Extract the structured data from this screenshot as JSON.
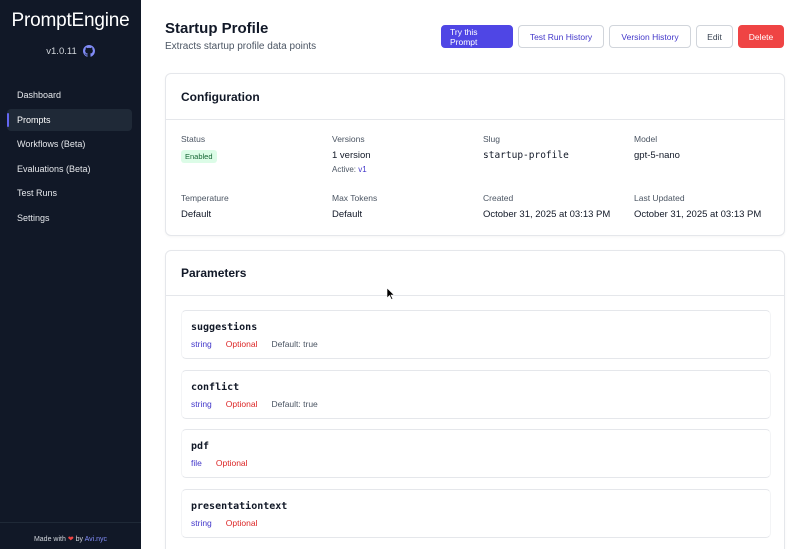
{
  "sidebar": {
    "brand": "PromptEngine",
    "version": "v1.0.11",
    "items": [
      {
        "label": "Dashboard"
      },
      {
        "label": "Prompts"
      },
      {
        "label": "Workflows (Beta)"
      },
      {
        "label": "Evaluations (Beta)"
      },
      {
        "label": "Test Runs"
      },
      {
        "label": "Settings"
      }
    ],
    "active_index": 1,
    "footer": {
      "made_with": "Made with",
      "by": "by",
      "author": "Avi.nyc"
    }
  },
  "header": {
    "title": "Startup Profile",
    "subtitle": "Extracts startup profile data points",
    "actions": {
      "try": "Try this Prompt",
      "history": "Test Run History",
      "versions": "Version History",
      "edit": "Edit",
      "delete": "Delete"
    }
  },
  "configuration": {
    "title": "Configuration",
    "status": {
      "label": "Status",
      "value": "Enabled"
    },
    "versions": {
      "label": "Versions",
      "value": "1 version",
      "active_label": "Active:",
      "active_value": "v1"
    },
    "slug": {
      "label": "Slug",
      "value": "startup-profile"
    },
    "model": {
      "label": "Model",
      "value": "gpt-5-nano"
    },
    "temperature": {
      "label": "Temperature",
      "value": "Default"
    },
    "max_tokens": {
      "label": "Max Tokens",
      "value": "Default"
    },
    "created": {
      "label": "Created",
      "value": "October 31, 2025 at 03:13 PM"
    },
    "updated": {
      "label": "Last Updated",
      "value": "October 31, 2025 at 03:13 PM"
    }
  },
  "parameters": {
    "title": "Parameters",
    "items": [
      {
        "name": "suggestions",
        "type": "string",
        "optional": "Optional",
        "default": "Default: true"
      },
      {
        "name": "conflict",
        "type": "string",
        "optional": "Optional",
        "default": "Default: true"
      },
      {
        "name": "pdf",
        "type": "file",
        "optional": "Optional"
      },
      {
        "name": "presentationtext",
        "type": "string",
        "optional": "Optional"
      }
    ]
  },
  "colors": {
    "sidebar_bg": "#111827",
    "accent": "#4f46e5",
    "danger": "#ef4444",
    "enabled_badge": "#dcfce7"
  }
}
